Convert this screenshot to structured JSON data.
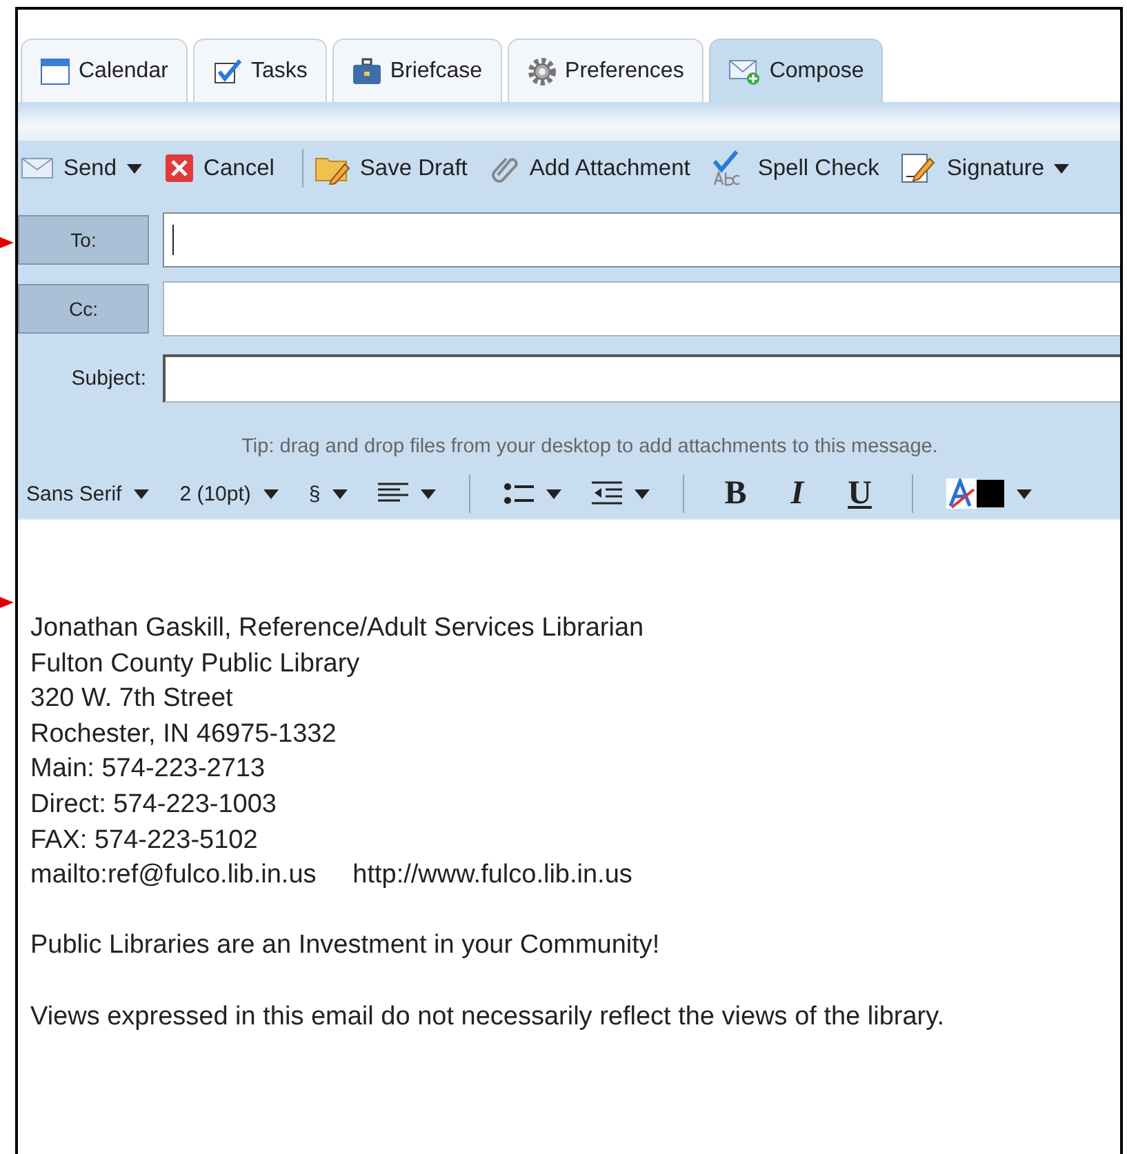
{
  "tabs": [
    {
      "label": "Calendar",
      "kind": "calendar",
      "selected": false
    },
    {
      "label": "Tasks",
      "kind": "tasks",
      "selected": false
    },
    {
      "label": "Briefcase",
      "kind": "briefcase",
      "selected": false
    },
    {
      "label": "Preferences",
      "kind": "preferences",
      "selected": false
    },
    {
      "label": "Compose",
      "kind": "compose",
      "selected": true
    }
  ],
  "toolbar": [
    {
      "label": "Send",
      "kind": "send"
    },
    {
      "label": "Cancel",
      "kind": "cancel"
    },
    {
      "kind": "separator"
    },
    {
      "label": "Save Draft",
      "kind": "save_draft"
    },
    {
      "label": "Add Attachment",
      "kind": "attachment"
    },
    {
      "label": "Spell Check",
      "kind": "spell_check"
    },
    {
      "label": "Signature",
      "kind": "signature"
    }
  ],
  "fields": [
    {
      "label": "To:",
      "kind": "button",
      "focused": true
    },
    {
      "label": "Cc:",
      "kind": "button",
      "focused": false
    },
    {
      "label": "Subject:",
      "kind": "label",
      "focused": false
    }
  ],
  "tip": "Tip: drag and drop files from your desktop to add attachments to this message.",
  "format_toolbar": [
    {
      "kind": "select",
      "label": "Sans Serif"
    },
    {
      "kind": "select",
      "label": "2 (10pt)"
    },
    {
      "kind": "select",
      "label": "§"
    },
    {
      "kind": "align"
    },
    {
      "kind": "separator"
    },
    {
      "kind": "bullets"
    },
    {
      "kind": "indent"
    },
    {
      "kind": "separator"
    },
    {
      "kind": "bold",
      "label": "B"
    },
    {
      "kind": "italic",
      "label": "I"
    },
    {
      "kind": "underline",
      "label": "U"
    },
    {
      "kind": "separator"
    },
    {
      "kind": "color"
    }
  ],
  "body_paragraphs": [
    [
      "Jonathan Gaskill, Reference/Adult Services Librarian",
      "Fulton County Public Library",
      "320 W. 7th Street",
      "Rochester, IN 46975-1332",
      "Main: 574-223-2713",
      "Direct: 574-223-1003",
      "FAX: 574-223-5102",
      "mailto:ref@fulco.lib.in.us     http://www.fulco.lib.in.us"
    ],
    [
      "Public Libraries are an Investment in your Community!"
    ],
    [
      "Views expressed in this email do not necessarily reflect the views of the library."
    ]
  ]
}
